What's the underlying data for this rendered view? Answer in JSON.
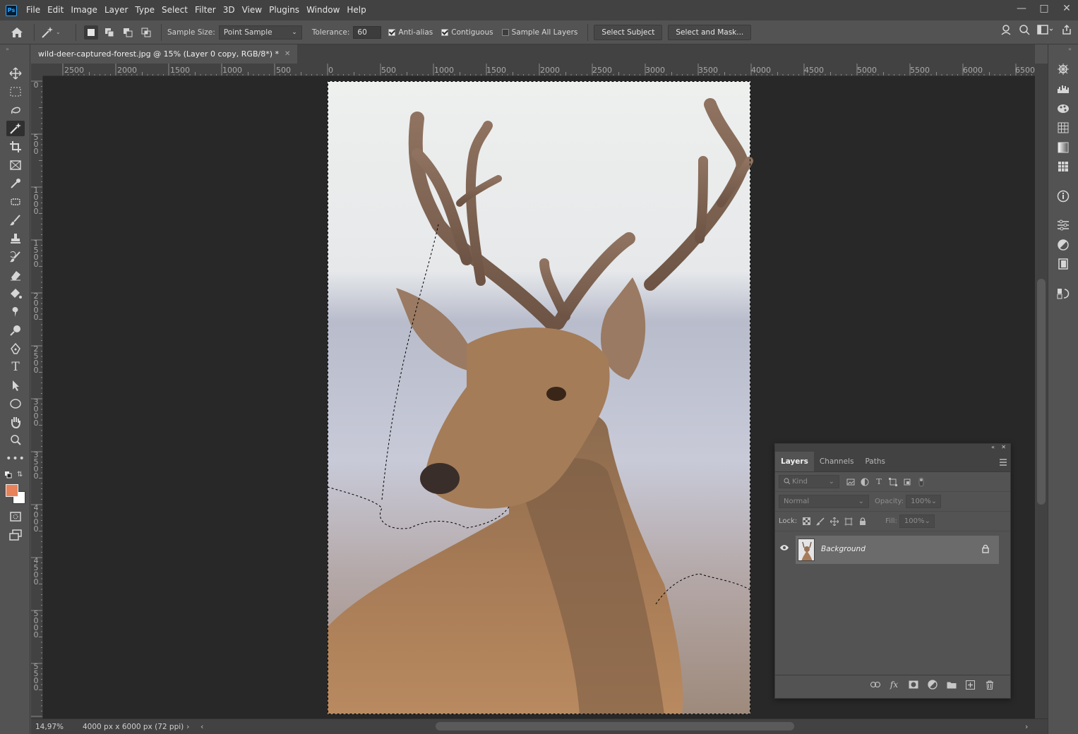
{
  "menu": {
    "items": [
      "File",
      "Edit",
      "Image",
      "Layer",
      "Type",
      "Select",
      "Filter",
      "3D",
      "View",
      "Plugins",
      "Window",
      "Help"
    ],
    "logo": "Ps"
  },
  "options": {
    "sample_size_label": "Sample Size:",
    "sample_size_value": "Point Sample",
    "tolerance_label": "Tolerance:",
    "tolerance_value": "60",
    "anti_alias": "Anti-alias",
    "contiguous": "Contiguous",
    "sample_all_layers": "Sample All Layers",
    "select_subject": "Select Subject",
    "select_and_mask": "Select and Mask..."
  },
  "document": {
    "tab_title": "wild-deer-captured-forest.jpg @ 15% (Layer 0 copy, RGB/8*) *"
  },
  "ruler": {
    "top": [
      "2500",
      "2000",
      "1500",
      "1000",
      "500",
      "0",
      "500",
      "1000",
      "1500",
      "2000",
      "2500",
      "3000",
      "3500",
      "4000",
      "4500",
      "5000",
      "5500",
      "6000",
      "6500"
    ],
    "left": [
      "0",
      "500",
      "1000",
      "1500",
      "2000",
      "2500",
      "3000",
      "3500",
      "4000",
      "4500",
      "5000",
      "5500"
    ]
  },
  "status": {
    "zoom": "14,97%",
    "doc_info": "4000 px x 6000 px (72 ppi)"
  },
  "layers_panel": {
    "tabs": [
      "Layers",
      "Channels",
      "Paths"
    ],
    "kind_placeholder": "Kind",
    "blend_mode": "Normal",
    "opacity_label": "Opacity:",
    "opacity_value": "100%",
    "lock_label": "Lock:",
    "fill_label": "Fill:",
    "fill_value": "100%",
    "layer_name": "Background",
    "fx_label": "fx"
  },
  "colors": {
    "foreground": "#e8825a",
    "background": "#ffffff",
    "accent": "#31a8ff"
  }
}
